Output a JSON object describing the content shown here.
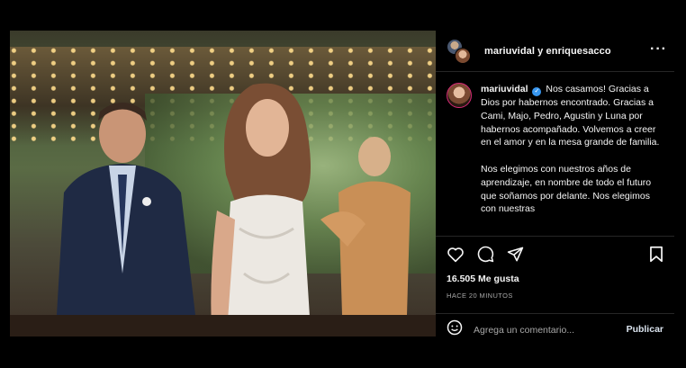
{
  "post": {
    "header_names": "mariuvidal y enriquesacco",
    "more_icon": "more-horizontal-icon",
    "caption": {
      "username": "mariuvidal",
      "paragraph1": "Nos casamos! Gracias a Dios por habernos encontrado. Gracias a Cami, Majo, Pedro, Agustin y Luna por habernos acompañado. Volvemos a creer en el amor y en la mesa grande de familia.",
      "paragraph2": "Nos elegimos con nuestros años de aprendizaje, en nombre de todo el futuro que soñamos por delante. Nos elegimos con nuestras"
    },
    "likes": "16.505 Me gusta",
    "time": "HACE 20 MINUTOS"
  },
  "comment": {
    "placeholder": "Agrega un comentario...",
    "publish_label": "Publicar"
  },
  "colors": {
    "background": "#000000",
    "divider": "#262626",
    "verified": "#3897f0",
    "secondary_text": "#a8a8a8"
  }
}
